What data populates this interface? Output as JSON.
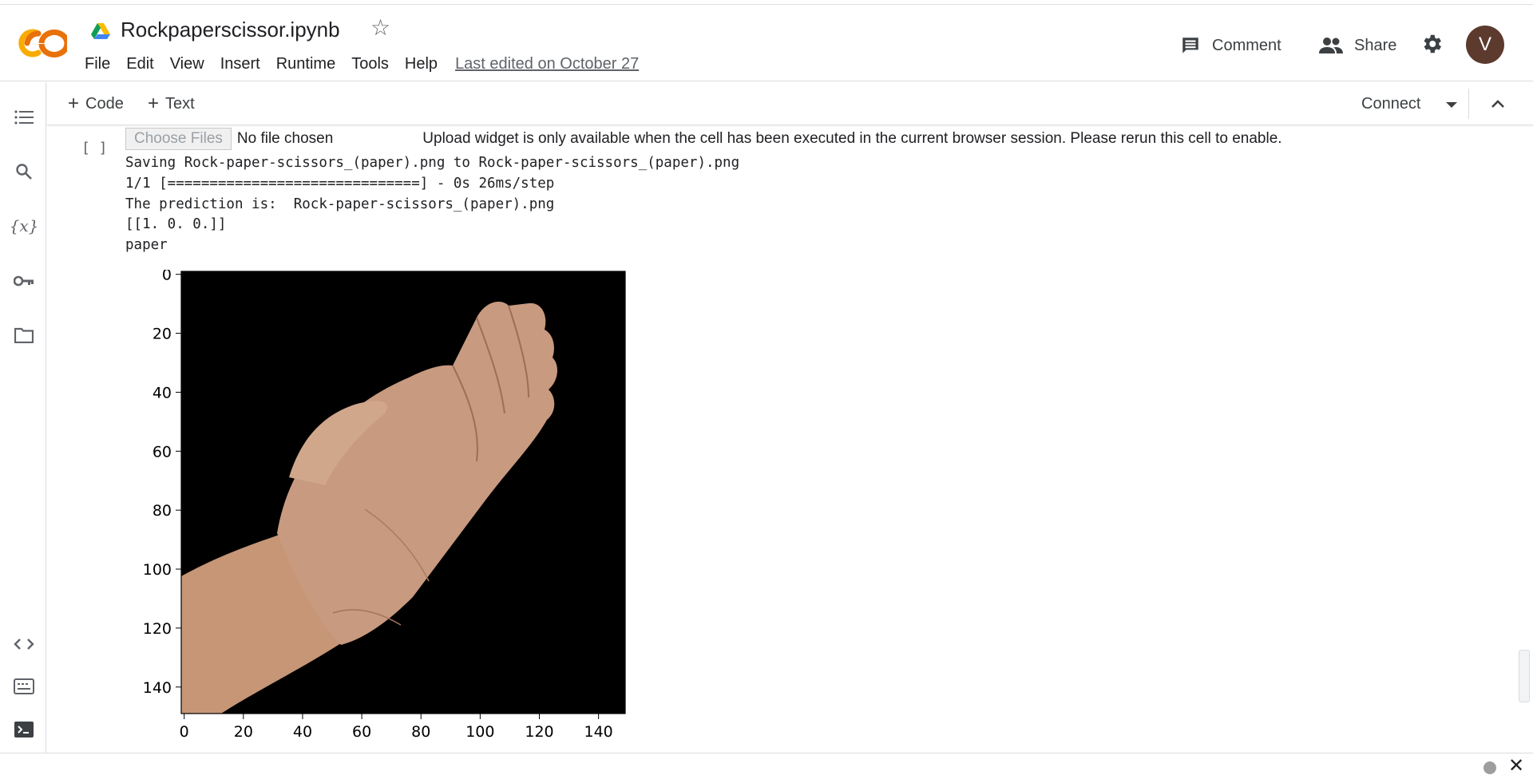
{
  "app": {
    "logo_text": "CO",
    "brand_orange": "#f9ab00",
    "brand_dark_orange": "#e8710a"
  },
  "header": {
    "title": "Rockpaperscissor.ipynb",
    "menu": [
      "File",
      "Edit",
      "View",
      "Insert",
      "Runtime",
      "Tools",
      "Help"
    ],
    "last_edited": "Last edited on October 27",
    "comment_label": "Comment",
    "share_label": "Share",
    "avatar_letter": "V",
    "avatar_color": "#5d3a2e"
  },
  "sidebar": {
    "icons": [
      "table-of-contents-icon",
      "search-icon",
      "variables-icon",
      "key-icon",
      "folder-icon",
      "code-snippets-icon",
      "command-palette-icon",
      "terminal-icon"
    ],
    "variables_glyph": "{x}"
  },
  "toolbar": {
    "add_code_label": "Code",
    "add_text_label": "Text",
    "plus_glyph": "+",
    "connect_label": "Connect"
  },
  "cell": {
    "execution_count": "[ ]",
    "choose_files_label": "Choose Files",
    "no_file_label": "No file chosen",
    "upload_message": "Upload widget is only available when the cell has been executed in the current browser session. Please rerun this cell to enable.",
    "output_lines": [
      "Saving Rock-paper-scissors_(paper).png to Rock-paper-scissors_(paper).png",
      "1/1 [==============================] - 0s 26ms/step",
      "The prediction is:  Rock-paper-scissors_(paper).png",
      "[[1. 0. 0.]]",
      "paper"
    ]
  },
  "chart_data": {
    "type": "image",
    "content": "hand (paper gesture) on black background",
    "xlim": [
      0,
      150
    ],
    "ylim": [
      150,
      0
    ],
    "xticks": [
      "0",
      "20",
      "40",
      "60",
      "80",
      "100",
      "120",
      "140"
    ],
    "yticks": [
      "0",
      "20",
      "40",
      "60",
      "80",
      "100",
      "120",
      "140"
    ],
    "background": "#000000",
    "skin_color": "#c89a80"
  },
  "status": {
    "close_glyph": "✕"
  }
}
